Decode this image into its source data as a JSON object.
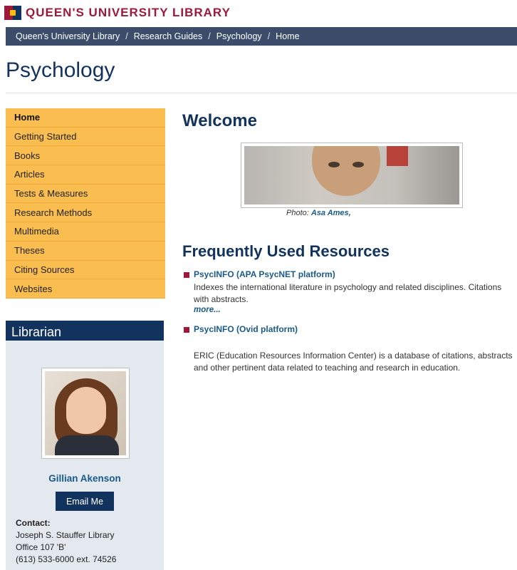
{
  "header": {
    "brand": "QUEEN'S UNIVERSITY LIBRARY"
  },
  "breadcrumb": {
    "items": [
      "Queen's University Library",
      "Research Guides",
      "Psychology",
      "Home"
    ]
  },
  "page": {
    "title": "Psychology"
  },
  "sidenav": {
    "items": [
      {
        "label": "Home",
        "active": true
      },
      {
        "label": "Getting Started"
      },
      {
        "label": "Books"
      },
      {
        "label": "Articles"
      },
      {
        "label": "Tests & Measures"
      },
      {
        "label": "Research Methods"
      },
      {
        "label": "Multimedia"
      },
      {
        "label": "Theses"
      },
      {
        "label": "Citing Sources"
      },
      {
        "label": "Websites"
      }
    ]
  },
  "librarian": {
    "heading": "Librarian",
    "name": "Gillian Akenson",
    "email_button": "Email Me",
    "contact_label": "Contact:",
    "contact_lines": [
      "Joseph S. Stauffer Library",
      "Office 107 'B'",
      "(613) 533-6000 ext. 74526"
    ]
  },
  "main": {
    "welcome": "Welcome",
    "photo_caption_prefix": "Photo:",
    "photo_credit": "Asa Ames,",
    "section_title": "Frequently Used Resources",
    "resources": [
      {
        "title": "PsycINFO (APA PsycNET platform)",
        "description": "Indexes the international literature in psychology and related disciplines. Citations with abstracts.",
        "more": "more..."
      },
      {
        "title": "PsycINFO (Ovid platform)",
        "description": "",
        "more": ""
      },
      {
        "title": "",
        "description": "ERIC (Education Resources Information Center) is a database of citations, abstracts and other pertinent data related to teaching and research in education.",
        "more": ""
      }
    ]
  },
  "colors": {
    "brand_red": "#9d1939",
    "navy": "#11335d",
    "nav_gold": "#fabd4f",
    "link_blue": "#1a5a8a"
  }
}
